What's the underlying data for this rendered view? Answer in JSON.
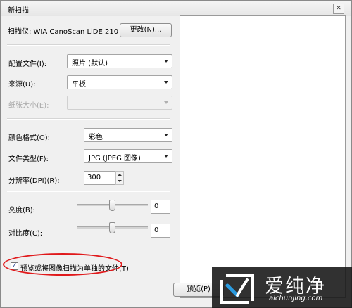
{
  "window": {
    "title": "新扫描",
    "close_glyph": "✕"
  },
  "scanner": {
    "label": "扫描仪: WIA CanoScan LiDE 210",
    "change_button": "更改(N)..."
  },
  "profile": {
    "label": "配置文件(I):",
    "value": "照片 (默认)"
  },
  "source": {
    "label": "来源(U):",
    "value": "平板"
  },
  "paper_size": {
    "label": "纸张大小(E):",
    "value": ""
  },
  "color_format": {
    "label": "颜色格式(O):",
    "value": "彩色"
  },
  "file_type": {
    "label": "文件类型(F):",
    "value": "JPG (JPEG 图像)"
  },
  "resolution": {
    "label": "分辨率(DPI)(R):",
    "value": "300"
  },
  "brightness": {
    "label": "亮度(B):",
    "value": "0"
  },
  "contrast": {
    "label": "对比度(C):",
    "value": "0"
  },
  "preview_checkbox": {
    "label": "预览或将图像扫描为单独的文件(T)",
    "checked": true,
    "check_glyph": "✓"
  },
  "preview_button": {
    "label": "预览(P)"
  },
  "watermark": {
    "brand_cn": "爱纯净",
    "brand_url": "aichunjing.com"
  },
  "colors": {
    "annotation": "#e0191b",
    "watermark_bg": "#141414"
  }
}
